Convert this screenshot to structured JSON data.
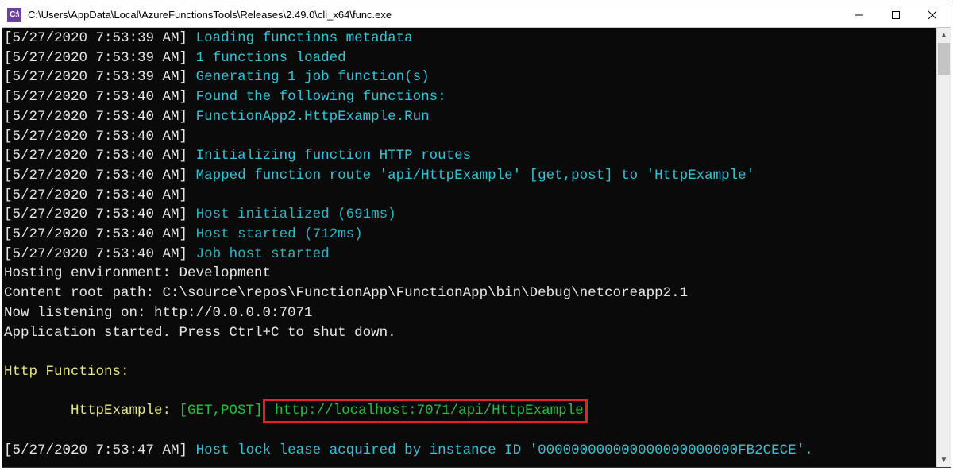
{
  "window": {
    "title": "C:\\Users\\AppData\\Local\\AzureFunctionsTools\\Releases\\2.49.0\\cli_x64\\func.exe",
    "icon_label": "C:\\"
  },
  "log": {
    "lines": [
      {
        "ts": "[5/27/2020 7:53:39 AM]",
        "msg": "Loading functions metadata",
        "cls": "cyan"
      },
      {
        "ts": "[5/27/2020 7:53:39 AM]",
        "msg": "1 functions loaded",
        "cls": "cyan"
      },
      {
        "ts": "[5/27/2020 7:53:39 AM]",
        "msg": "Generating 1 job function(s)",
        "cls": "cyan"
      },
      {
        "ts": "[5/27/2020 7:53:40 AM]",
        "msg": "Found the following functions:",
        "cls": "cyan"
      },
      {
        "ts": "[5/27/2020 7:53:40 AM]",
        "msg": "FunctionApp2.HttpExample.Run",
        "cls": "cyan"
      },
      {
        "ts": "[5/27/2020 7:53:40 AM]",
        "msg": "",
        "cls": ""
      },
      {
        "ts": "[5/27/2020 7:53:40 AM]",
        "msg": "Initializing function HTTP routes",
        "cls": "cyan"
      },
      {
        "ts": "[5/27/2020 7:53:40 AM]",
        "msg": "Mapped function route 'api/HttpExample' [get,post] to 'HttpExample'",
        "cls": "cyan"
      },
      {
        "ts": "[5/27/2020 7:53:40 AM]",
        "msg": "",
        "cls": ""
      },
      {
        "ts": "[5/27/2020 7:53:40 AM]",
        "msg": "Host initialized (691ms)",
        "cls": "cyan-dim"
      },
      {
        "ts": "[5/27/2020 7:53:40 AM]",
        "msg": "Host started (712ms)",
        "cls": "cyan-dim"
      },
      {
        "ts": "[5/27/2020 7:53:40 AM]",
        "msg": "Job host started",
        "cls": "cyan-dim"
      }
    ],
    "plain": [
      "Hosting environment: Development",
      "Content root path: C:\\source\\repos\\FunctionApp\\FunctionApp\\bin\\Debug\\netcoreapp2.1",
      "Now listening on: http://0.0.0.0:7071",
      "Application started. Press Ctrl+C to shut down.",
      ""
    ],
    "funcs_header": "Http Functions:",
    "funcs_blank": "",
    "func_indent": "        ",
    "func_name": "HttpExample: ",
    "func_methods": "[GET,POST]",
    "func_sep": " ",
    "func_url": "http://localhost:7071/api/HttpExample",
    "tail_blank": "",
    "tail": {
      "ts": "[5/27/2020 7:53:47 AM]",
      "msg": "Host lock lease acquired by instance ID '000000000000000000000000FB2CECE'.",
      "cls": "cyan"
    }
  }
}
